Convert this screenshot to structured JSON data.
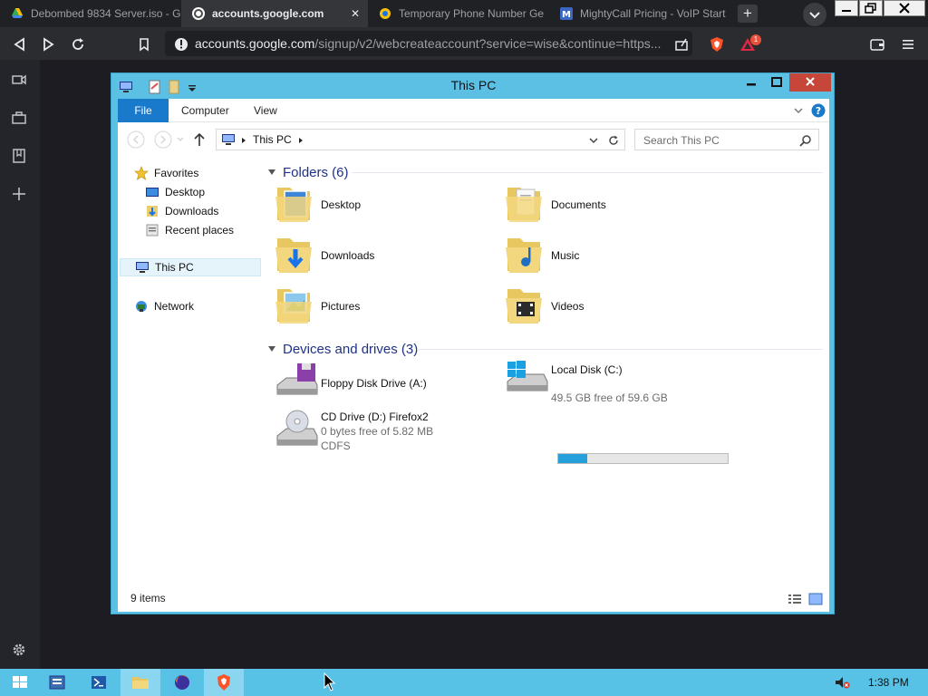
{
  "browser": {
    "tabs": [
      {
        "title": "Debombed 9834 Server.iso - G",
        "active": false,
        "icon": "google-drive-icon"
      },
      {
        "title": "accounts.google.com",
        "active": true,
        "icon": "google-icon"
      },
      {
        "title": "Temporary Phone Number Ge",
        "active": false,
        "icon": "phone-app-icon"
      },
      {
        "title": "MightyCall Pricing - VoIP Start",
        "active": false,
        "icon": "mightycall-icon"
      }
    ],
    "tab_close_glyph": "✕",
    "new_tab_glyph": "+",
    "url_host": "accounts.google.com",
    "url_path": "/signup/v2/webcreateaccount?service=wise&continue=https...",
    "shield_badge": "1",
    "accent_brave": "#fb542b"
  },
  "explorer": {
    "title": "This PC",
    "ribbon_tabs": [
      "File",
      "Computer",
      "View"
    ],
    "breadcrumb": "This PC",
    "search_placeholder": "Search This PC",
    "nav": {
      "favorites": "Favorites",
      "favorite_items": [
        "Desktop",
        "Downloads",
        "Recent places"
      ],
      "this_pc": "This PC",
      "network": "Network"
    },
    "folders_group": "Folders (6)",
    "folders": [
      "Desktop",
      "Documents",
      "Downloads",
      "Music",
      "Pictures",
      "Videos"
    ],
    "devices_group": "Devices and drives (3)",
    "drives": [
      {
        "name": "Floppy Disk Drive (A:)",
        "free": "",
        "fs": ""
      },
      {
        "name": "Local Disk (C:)",
        "free": "49.5 GB free of 59.6 GB",
        "fs": "",
        "used_fraction": 0.17
      },
      {
        "name": "CD Drive (D:) Firefox2",
        "free": "0 bytes free of 5.82 MB",
        "fs": "CDFS"
      }
    ],
    "status": "9 items"
  },
  "taskbar": {
    "clock": "1:38 PM"
  }
}
